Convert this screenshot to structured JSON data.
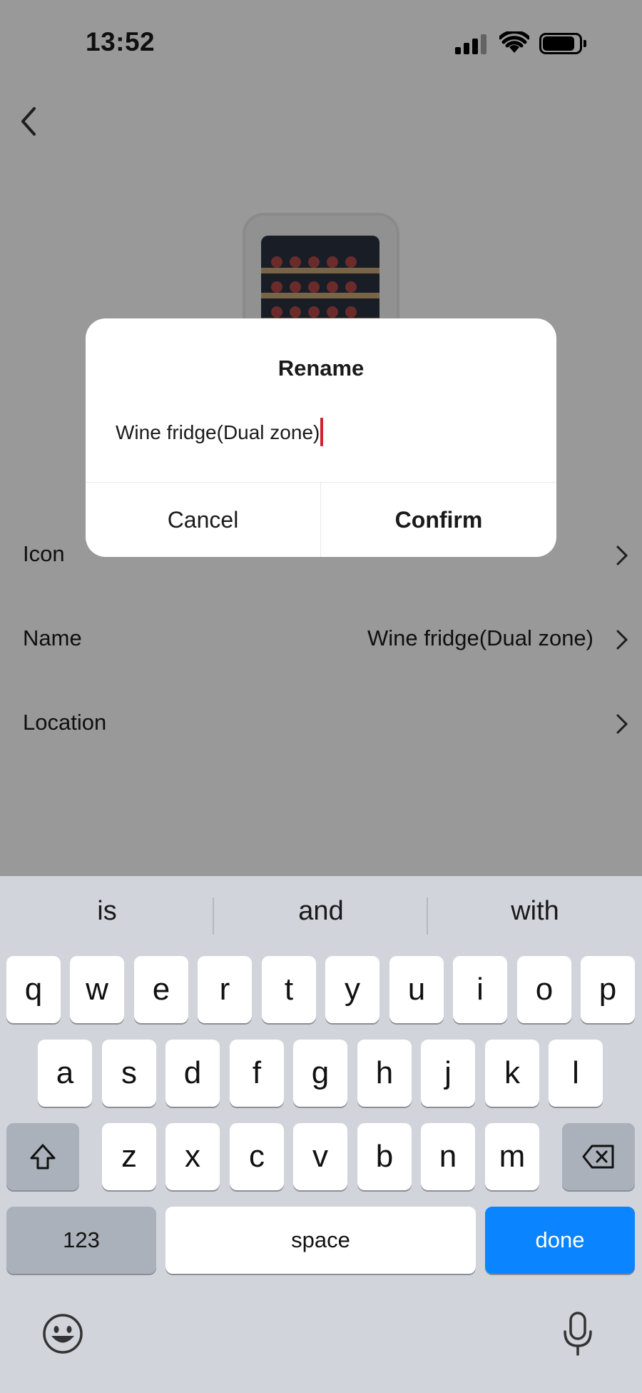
{
  "status_bar": {
    "time": "13:52"
  },
  "settings": {
    "rows": [
      {
        "label": "Icon",
        "value": ""
      },
      {
        "label": "Name",
        "value": "Wine fridge(Dual zone)"
      },
      {
        "label": "Location",
        "value": ""
      }
    ]
  },
  "dialog": {
    "title": "Rename",
    "input_value": "Wine fridge(Dual zone)",
    "cancel_label": "Cancel",
    "confirm_label": "Confirm"
  },
  "keyboard": {
    "suggestions": [
      "is",
      "and",
      "with"
    ],
    "row1": [
      "q",
      "w",
      "e",
      "r",
      "t",
      "y",
      "u",
      "i",
      "o",
      "p"
    ],
    "row2": [
      "a",
      "s",
      "d",
      "f",
      "g",
      "h",
      "j",
      "k",
      "l"
    ],
    "row3": [
      "z",
      "x",
      "c",
      "v",
      "b",
      "n",
      "m"
    ],
    "numbers_label": "123",
    "space_label": "space",
    "done_label": "done",
    "done_color": "#0a84ff"
  },
  "icons": [
    "back-icon",
    "signal-icon",
    "wifi-icon",
    "battery-icon",
    "chevron-right-icon",
    "shift-icon",
    "delete-icon",
    "emoji-icon",
    "microphone-icon"
  ]
}
